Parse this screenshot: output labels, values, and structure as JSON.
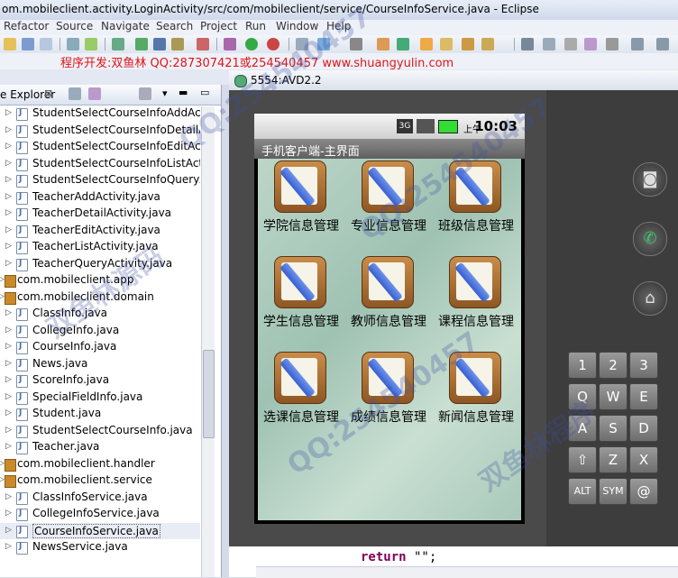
{
  "window": {
    "title": "om.mobileclient.activity.LoginActivity/src/com/mobileclient/service/CourseInfoService.java - Eclipse"
  },
  "menu": [
    "Refactor",
    "Source",
    "Navigate",
    "Search",
    "Project",
    "Run",
    "Window",
    "Help"
  ],
  "banner": "程序开发:双鱼林 QQ:287307421或254540457 www.shuangyulin.com",
  "explorer": {
    "tab_label": "e Explorer",
    "close_glyph": "⊠",
    "items": [
      {
        "label": "StudentSelectCourseInfoAddActivit",
        "type": "java",
        "level": 1
      },
      {
        "label": "StudentSelectCourseInfoDetailActiv",
        "type": "java",
        "level": 1
      },
      {
        "label": "StudentSelectCourseInfoEditActivit",
        "type": "java",
        "level": 1
      },
      {
        "label": "StudentSelectCourseInfoListActivity",
        "type": "java",
        "level": 1
      },
      {
        "label": "StudentSelectCourseInfoQueryActi",
        "type": "java",
        "level": 1
      },
      {
        "label": "TeacherAddActivity.java",
        "type": "java",
        "level": 1
      },
      {
        "label": "TeacherDetailActivity.java",
        "type": "java",
        "level": 1
      },
      {
        "label": "TeacherEditActivity.java",
        "type": "java",
        "level": 1
      },
      {
        "label": "TeacherListActivity.java",
        "type": "java",
        "level": 1
      },
      {
        "label": "TeacherQueryActivity.java",
        "type": "java",
        "level": 1
      },
      {
        "label": "com.mobileclient.app",
        "type": "pkg",
        "level": 0
      },
      {
        "label": "com.mobileclient.domain",
        "type": "pkg",
        "level": 0
      },
      {
        "label": "ClassInfo.java",
        "type": "java",
        "level": 1
      },
      {
        "label": "CollegeInfo.java",
        "type": "java",
        "level": 1
      },
      {
        "label": "CourseInfo.java",
        "type": "java",
        "level": 1
      },
      {
        "label": "News.java",
        "type": "java",
        "level": 1
      },
      {
        "label": "ScoreInfo.java",
        "type": "java",
        "level": 1
      },
      {
        "label": "SpecialFieldInfo.java",
        "type": "java",
        "level": 1
      },
      {
        "label": "Student.java",
        "type": "java",
        "level": 1
      },
      {
        "label": "StudentSelectCourseInfo.java",
        "type": "java",
        "level": 1
      },
      {
        "label": "Teacher.java",
        "type": "java",
        "level": 1
      },
      {
        "label": "com.mobileclient.handler",
        "type": "pkg",
        "level": 0
      },
      {
        "label": "com.mobileclient.service",
        "type": "pkg",
        "level": 0
      },
      {
        "label": "ClassInfoService.java",
        "type": "java",
        "level": 1
      },
      {
        "label": "CollegeInfoService.java",
        "type": "java",
        "level": 1
      },
      {
        "label": "CourseInfoService.java",
        "type": "java",
        "level": 1,
        "selected": true
      },
      {
        "label": "NewsService.java",
        "type": "java",
        "level": 1
      }
    ]
  },
  "emulator": {
    "title": "5554:AVD2.2",
    "status": {
      "net": "3G",
      "ampm": "上午",
      "time": "10:03"
    },
    "app_title": "手机客户端-主界面",
    "tiles": [
      "学院信息管理",
      "专业信息管理",
      "班级信息管理",
      "学生信息管理",
      "教师信息管理",
      "课程信息管理",
      "选课信息管理",
      "成绩信息管理",
      "新闻信息管理"
    ],
    "keys": [
      "1",
      "2",
      "3",
      "Q",
      "W",
      "E",
      "A",
      "S",
      "D",
      "⇧",
      "Z",
      "X",
      "ALT",
      "SYM",
      "@"
    ]
  },
  "code": {
    "keyword": "return",
    "rest": " \"\";"
  }
}
